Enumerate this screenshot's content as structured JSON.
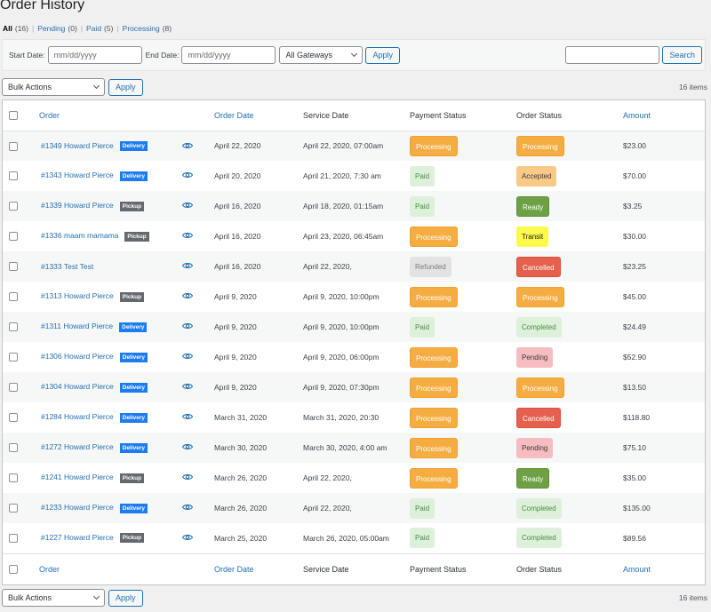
{
  "page": {
    "title": "Order History"
  },
  "views": [
    {
      "label": "All",
      "count": "(16)",
      "current": true
    },
    {
      "label": "Pending",
      "count": "(0)",
      "current": false
    },
    {
      "label": "Paid",
      "count": "(5)",
      "current": false
    },
    {
      "label": "Processing",
      "count": "(8)",
      "current": false
    }
  ],
  "filters": {
    "start_date_label": "Start Date:",
    "start_date_placeholder": "mm/dd/yyyy",
    "end_date_label": "End Date:",
    "end_date_placeholder": "mm/dd/yyyy",
    "gateway_selected": "All Gateways",
    "apply_label": "Apply",
    "search_value": "",
    "search_label": "Search"
  },
  "tablenav_top": {
    "bulk_selected": "Bulk Actions",
    "apply_label": "Apply",
    "items_count": "16 items"
  },
  "tablenav_bottom": {
    "bulk_selected": "Bulk Actions",
    "apply_label": "Apply",
    "items_count": "16 items"
  },
  "columns": {
    "order": "Order",
    "order_date": "Order Date",
    "service_date": "Service Date",
    "payment_status": "Payment Status",
    "order_status": "Order Status",
    "amount": "Amount"
  },
  "type_labels": {
    "delivery": "Delivery",
    "pickup": "Pickup"
  },
  "colors": {
    "link": "#2271b1",
    "delivery_badge": "#1e7cf2",
    "pickup_badge": "#646970",
    "processing": "#f5ad42",
    "paid": "#ddf0d9",
    "refunded": "#e3e3e3",
    "accepted": "#f8c987",
    "ready": "#6ea146",
    "transit": "#fcf94d",
    "cancelled": "#e5604d",
    "completed": "#ddf0d9",
    "pending": "#f6bcbf"
  },
  "orders": [
    {
      "order": "#1349 Howard Pierce",
      "type": "delivery",
      "order_date": "April 22, 2020",
      "service_date": "April 22, 2020, 07:00am",
      "payment_status": "Processing",
      "order_status": "Processing",
      "amount": "$23.00"
    },
    {
      "order": "#1343 Howard Pierce",
      "type": "delivery",
      "order_date": "April 20, 2020",
      "service_date": "April 21, 2020, 7:30 am",
      "payment_status": "Paid",
      "order_status": "Accepted",
      "amount": "$70.00"
    },
    {
      "order": "#1339 Howard Pierce",
      "type": "pickup",
      "order_date": "April 16, 2020",
      "service_date": "April 18, 2020, 01:15am",
      "payment_status": "Paid",
      "order_status": "Ready",
      "amount": "$3.25"
    },
    {
      "order": "#1336 maam mamama",
      "type": "pickup",
      "order_date": "April 16, 2020",
      "service_date": "April 23, 2020, 06:45am",
      "payment_status": "Processing",
      "order_status": "Transit",
      "amount": "$30.00"
    },
    {
      "order": "#1333 Test Test",
      "type": "",
      "order_date": "April 16, 2020",
      "service_date": "April 22, 2020,",
      "payment_status": "Refunded",
      "order_status": "Cancelled",
      "amount": "$23.25"
    },
    {
      "order": "#1313 Howard Pierce",
      "type": "pickup",
      "order_date": "April 9, 2020",
      "service_date": "April 9, 2020, 10:00pm",
      "payment_status": "Processing",
      "order_status": "Processing",
      "amount": "$45.00"
    },
    {
      "order": "#1311 Howard Pierce",
      "type": "delivery",
      "order_date": "April 9, 2020",
      "service_date": "April 9, 2020, 10:00pm",
      "payment_status": "Paid",
      "order_status": "Completed",
      "amount": "$24.49"
    },
    {
      "order": "#1306 Howard Pierce",
      "type": "delivery",
      "order_date": "April 9, 2020",
      "service_date": "April 9, 2020, 06:00pm",
      "payment_status": "Processing",
      "order_status": "Pending",
      "amount": "$52.90"
    },
    {
      "order": "#1304 Howard Pierce",
      "type": "delivery",
      "order_date": "April 9, 2020",
      "service_date": "April 9, 2020, 07:30pm",
      "payment_status": "Processing",
      "order_status": "Processing",
      "amount": "$13.50"
    },
    {
      "order": "#1284 Howard Pierce",
      "type": "delivery",
      "order_date": "March 31, 2020",
      "service_date": "March 31, 2020, 20:30",
      "payment_status": "Processing",
      "order_status": "Cancelled",
      "amount": "$118.80"
    },
    {
      "order": "#1272 Howard Pierce",
      "type": "delivery",
      "order_date": "March 30, 2020",
      "service_date": "March 30, 2020, 4:00 am",
      "payment_status": "Processing",
      "order_status": "Pending",
      "amount": "$75.10"
    },
    {
      "order": "#1241 Howard Pierce",
      "type": "pickup",
      "order_date": "March 26, 2020",
      "service_date": "April 22, 2020,",
      "payment_status": "Processing",
      "order_status": "Ready",
      "amount": "$35.00"
    },
    {
      "order": "#1233 Howard Pierce",
      "type": "delivery",
      "order_date": "March 26, 2020",
      "service_date": "April 22, 2020,",
      "payment_status": "Paid",
      "order_status": "Completed",
      "amount": "$135.00"
    },
    {
      "order": "#1227 Howard Pierce",
      "type": "pickup",
      "order_date": "March 25, 2020",
      "service_date": "March 26, 2020, 05:00am",
      "payment_status": "Paid",
      "order_status": "Completed",
      "amount": "$89.56"
    }
  ]
}
